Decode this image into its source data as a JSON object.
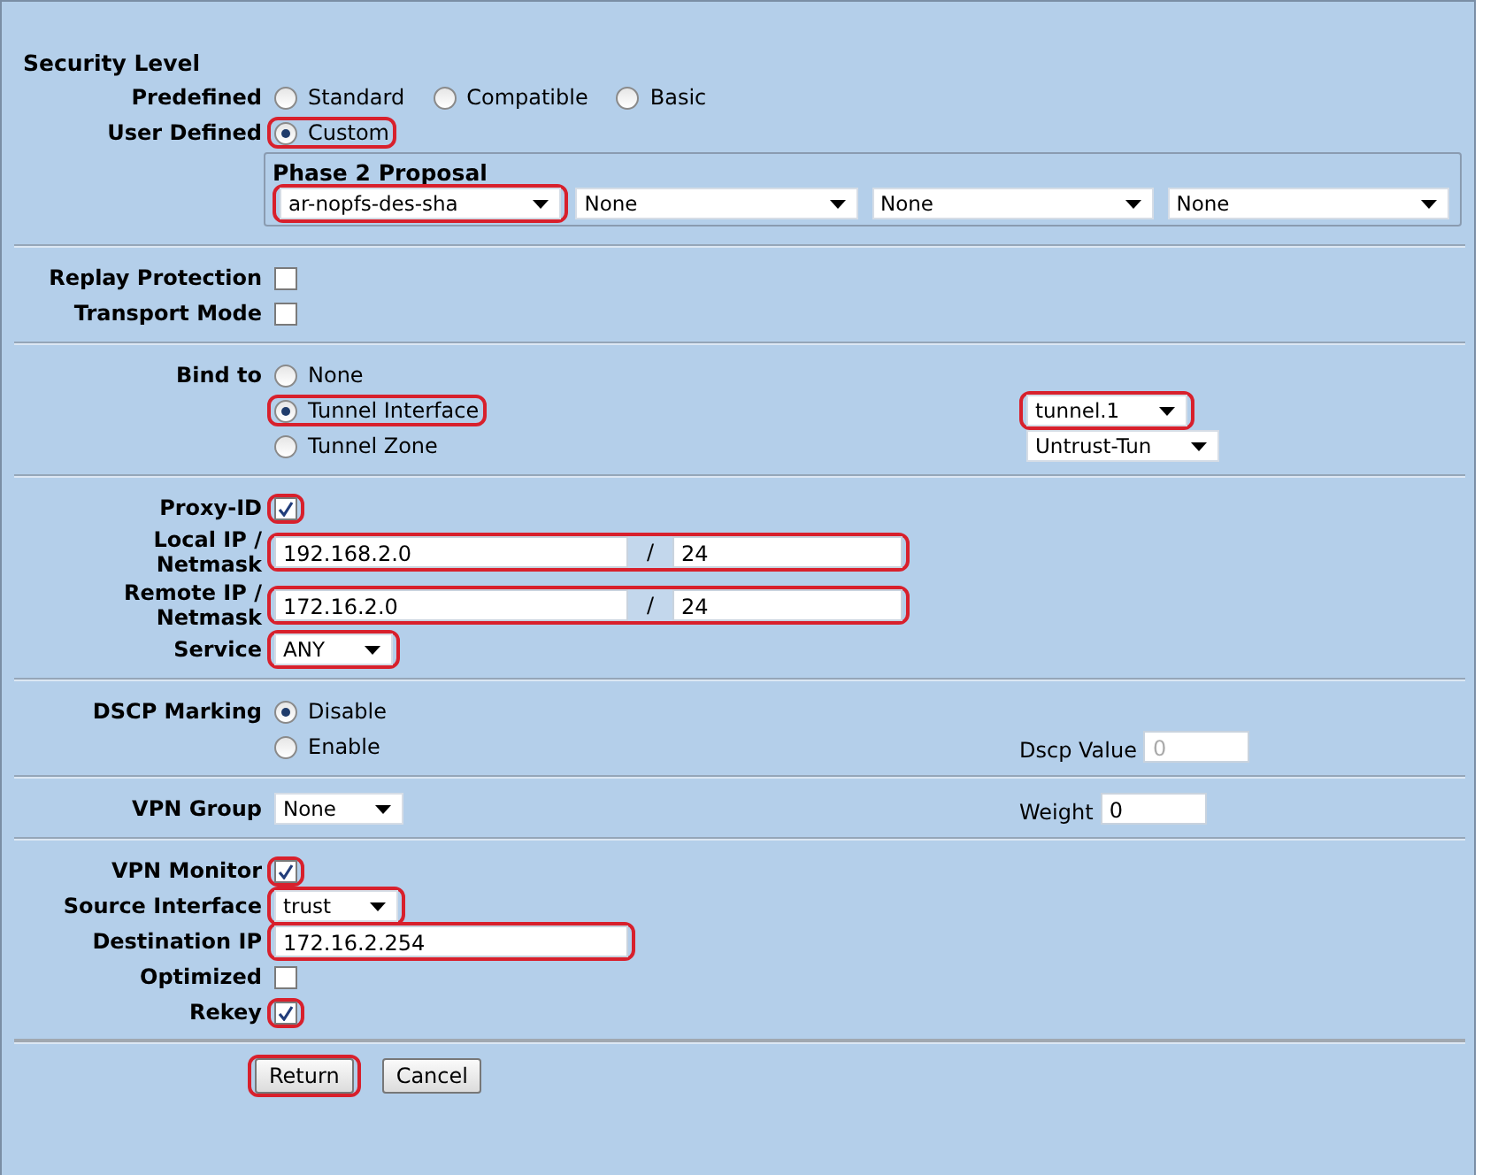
{
  "sections": [
    {
      "rows": [
        {
          "kind": "heading",
          "text": "Security Level"
        },
        {
          "kind": "radios",
          "label": "Predefined",
          "options": [
            {
              "label": "Standard",
              "selected": false,
              "highlighted": false
            },
            {
              "label": "Compatible",
              "selected": false,
              "highlighted": false
            },
            {
              "label": "Basic",
              "selected": false,
              "highlighted": false
            }
          ]
        },
        {
          "kind": "radios",
          "label": "User Defined",
          "options": [
            {
              "label": "Custom",
              "selected": true,
              "highlighted": true
            }
          ]
        },
        {
          "kind": "fieldset",
          "title": "Phase 2 Proposal",
          "selects": [
            {
              "value": "ar-nopfs-des-sha",
              "highlighted": true
            },
            {
              "value": "None",
              "highlighted": false
            },
            {
              "value": "None",
              "highlighted": false
            },
            {
              "value": "None",
              "highlighted": false
            }
          ]
        }
      ]
    },
    {
      "rows": [
        {
          "kind": "checkbox",
          "label": "Replay Protection",
          "checked": false,
          "highlighted": false
        },
        {
          "kind": "checkbox",
          "label": "Transport Mode",
          "checked": false,
          "highlighted": false
        }
      ]
    },
    {
      "rows": [
        {
          "kind": "radios",
          "label": "Bind to",
          "options": [
            {
              "label": "None",
              "selected": false,
              "highlighted": false
            }
          ]
        },
        {
          "kind": "radios",
          "options": [
            {
              "label": "Tunnel Interface",
              "selected": true,
              "highlighted": true
            }
          ],
          "right": {
            "kind": "select",
            "value": "tunnel.1",
            "highlighted": true
          }
        },
        {
          "kind": "radios",
          "options": [
            {
              "label": "Tunnel Zone",
              "selected": false,
              "highlighted": false
            }
          ],
          "right": {
            "kind": "select",
            "value": "Untrust-Tun",
            "highlighted": false
          }
        }
      ]
    },
    {
      "rows": [
        {
          "kind": "checkbox",
          "label": "Proxy-ID",
          "checked": true,
          "highlighted": true
        },
        {
          "kind": "ip",
          "label": "Local IP / Netmask",
          "address": "192.168.2.0",
          "separator": "/",
          "mask": "24",
          "highlighted": true
        },
        {
          "kind": "ip",
          "label": "Remote IP / Netmask",
          "address": "172.16.2.0",
          "separator": "/",
          "mask": "24",
          "highlighted": true
        },
        {
          "kind": "select",
          "label": "Service",
          "value": "ANY",
          "highlighted": true
        }
      ]
    },
    {
      "rows": [
        {
          "kind": "radios",
          "label": "DSCP Marking",
          "options": [
            {
              "label": "Disable",
              "selected": true,
              "highlighted": false
            }
          ]
        },
        {
          "kind": "radios",
          "options": [
            {
              "label": "Enable",
              "selected": false,
              "highlighted": false
            }
          ],
          "right": {
            "kind": "input",
            "label": "Dscp Value",
            "value": "0",
            "disabled": true
          }
        }
      ]
    },
    {
      "rows": [
        {
          "kind": "select",
          "label": "VPN Group",
          "value": "None",
          "highlighted": false,
          "right": {
            "kind": "input",
            "label": "Weight",
            "value": "0",
            "disabled": false
          }
        }
      ]
    },
    {
      "rows": [
        {
          "kind": "checkbox",
          "label": "VPN Monitor",
          "checked": true,
          "highlighted": true
        },
        {
          "kind": "select",
          "label": "Source Interface",
          "value": "trust",
          "highlighted": true
        },
        {
          "kind": "input",
          "label": "Destination IP",
          "value": "172.16.2.254",
          "highlighted": true
        },
        {
          "kind": "checkbox",
          "label": "Optimized",
          "checked": false,
          "highlighted": false
        },
        {
          "kind": "checkbox",
          "label": "Rekey",
          "checked": true,
          "highlighted": true
        }
      ]
    }
  ],
  "buttons": [
    {
      "label": "Return",
      "highlighted": true
    },
    {
      "label": "Cancel",
      "highlighted": false
    }
  ]
}
